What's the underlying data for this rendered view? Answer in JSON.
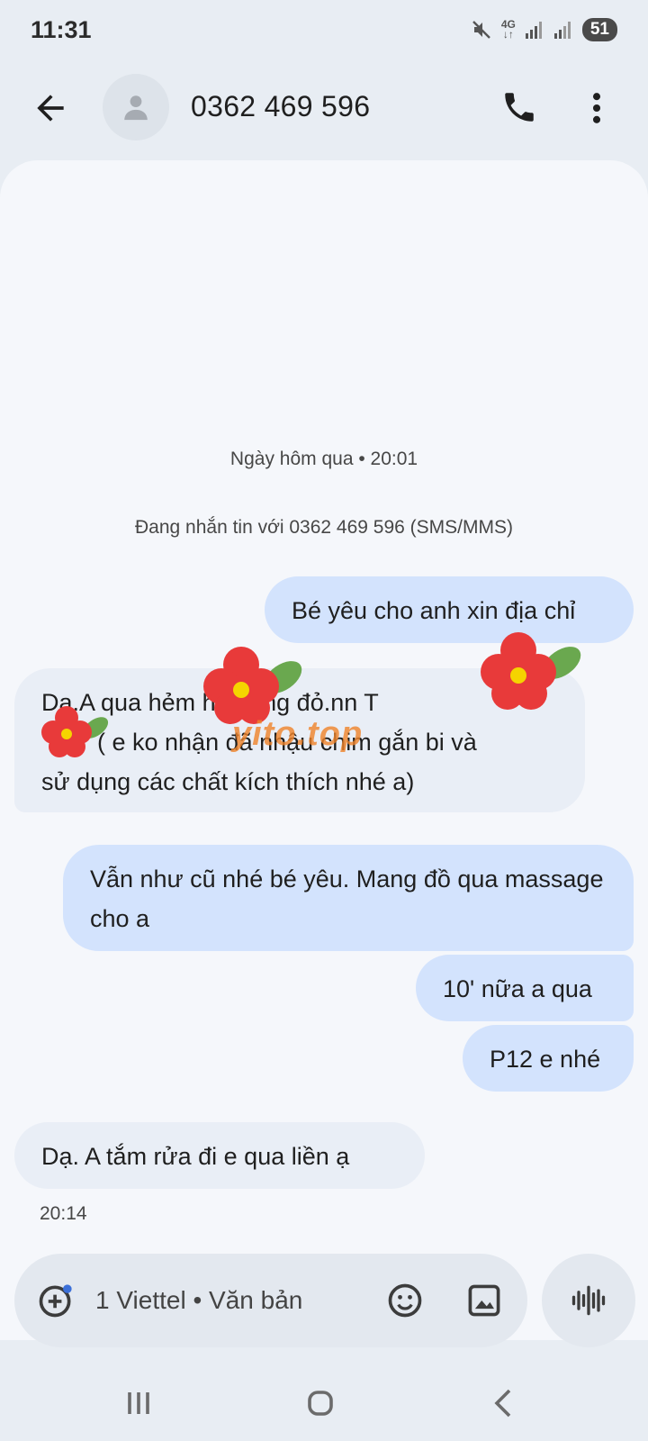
{
  "status": {
    "time": "11:31",
    "network": "4G",
    "battery": "51"
  },
  "header": {
    "contact": "0362 469 596"
  },
  "conversation": {
    "date_label": "Ngày hôm qua • 20:01",
    "info_label": "Đang nhắn tin với 0362 469 596 (SMS/MMS)",
    "messages": [
      {
        "direction": "out",
        "text": "Bé yêu cho anh xin địa chỉ"
      },
      {
        "direction": "in",
        "line1": "Dạ.A qua hẻm      hú riềng đỏ.nn T",
        "line2": "( e ko nhận đã nhậu chim gắn bi và",
        "line3": "sử dụng các chất kích thích nhé a)"
      },
      {
        "direction": "out",
        "text": "Vẫn như cũ nhé bé yêu. Mang đồ qua massage cho a"
      },
      {
        "direction": "out",
        "text": "10' nữa a qua"
      },
      {
        "direction": "out",
        "text": "P12 e nhé"
      },
      {
        "direction": "in",
        "text": "Dạ. A tắm rửa đi e qua liền ạ"
      }
    ],
    "last_time": "20:14",
    "watermark": "yito.top"
  },
  "composer": {
    "placeholder": "1 Viettel • Văn bản"
  },
  "icons": {
    "back": "arrow-left-icon",
    "avatar": "person-icon",
    "call": "phone-icon",
    "more": "more-vert-icon",
    "add": "add-circle-icon",
    "emoji": "emoji-icon",
    "image": "image-icon",
    "voice": "voice-wave-icon",
    "nav_recent": "recents-icon",
    "nav_home": "home-icon",
    "nav_back": "nav-back-icon"
  },
  "colors": {
    "outgoing_bubble": "#d3e3fd",
    "incoming_bubble": "#e9eef6",
    "background": "#f5f7fb"
  }
}
